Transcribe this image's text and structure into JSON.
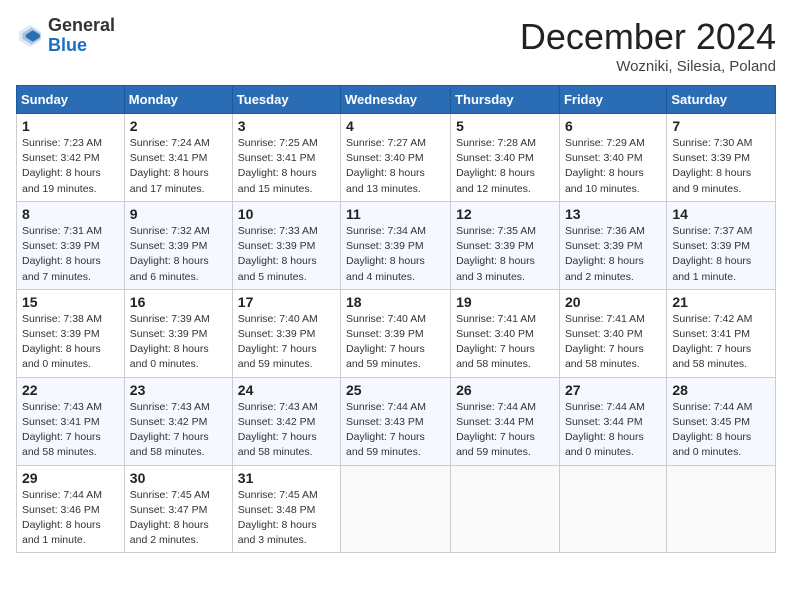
{
  "header": {
    "logo_general": "General",
    "logo_blue": "Blue",
    "month_title": "December 2024",
    "location": "Wozniki, Silesia, Poland"
  },
  "days_of_week": [
    "Sunday",
    "Monday",
    "Tuesday",
    "Wednesday",
    "Thursday",
    "Friday",
    "Saturday"
  ],
  "weeks": [
    [
      {
        "day": 1,
        "sunrise": "7:23 AM",
        "sunset": "3:42 PM",
        "daylight": "8 hours and 19 minutes."
      },
      {
        "day": 2,
        "sunrise": "7:24 AM",
        "sunset": "3:41 PM",
        "daylight": "8 hours and 17 minutes."
      },
      {
        "day": 3,
        "sunrise": "7:25 AM",
        "sunset": "3:41 PM",
        "daylight": "8 hours and 15 minutes."
      },
      {
        "day": 4,
        "sunrise": "7:27 AM",
        "sunset": "3:40 PM",
        "daylight": "8 hours and 13 minutes."
      },
      {
        "day": 5,
        "sunrise": "7:28 AM",
        "sunset": "3:40 PM",
        "daylight": "8 hours and 12 minutes."
      },
      {
        "day": 6,
        "sunrise": "7:29 AM",
        "sunset": "3:40 PM",
        "daylight": "8 hours and 10 minutes."
      },
      {
        "day": 7,
        "sunrise": "7:30 AM",
        "sunset": "3:39 PM",
        "daylight": "8 hours and 9 minutes."
      }
    ],
    [
      {
        "day": 8,
        "sunrise": "7:31 AM",
        "sunset": "3:39 PM",
        "daylight": "8 hours and 7 minutes."
      },
      {
        "day": 9,
        "sunrise": "7:32 AM",
        "sunset": "3:39 PM",
        "daylight": "8 hours and 6 minutes."
      },
      {
        "day": 10,
        "sunrise": "7:33 AM",
        "sunset": "3:39 PM",
        "daylight": "8 hours and 5 minutes."
      },
      {
        "day": 11,
        "sunrise": "7:34 AM",
        "sunset": "3:39 PM",
        "daylight": "8 hours and 4 minutes."
      },
      {
        "day": 12,
        "sunrise": "7:35 AM",
        "sunset": "3:39 PM",
        "daylight": "8 hours and 3 minutes."
      },
      {
        "day": 13,
        "sunrise": "7:36 AM",
        "sunset": "3:39 PM",
        "daylight": "8 hours and 2 minutes."
      },
      {
        "day": 14,
        "sunrise": "7:37 AM",
        "sunset": "3:39 PM",
        "daylight": "8 hours and 1 minute."
      }
    ],
    [
      {
        "day": 15,
        "sunrise": "7:38 AM",
        "sunset": "3:39 PM",
        "daylight": "8 hours and 0 minutes."
      },
      {
        "day": 16,
        "sunrise": "7:39 AM",
        "sunset": "3:39 PM",
        "daylight": "8 hours and 0 minutes."
      },
      {
        "day": 17,
        "sunrise": "7:40 AM",
        "sunset": "3:39 PM",
        "daylight": "7 hours and 59 minutes."
      },
      {
        "day": 18,
        "sunrise": "7:40 AM",
        "sunset": "3:39 PM",
        "daylight": "7 hours and 59 minutes."
      },
      {
        "day": 19,
        "sunrise": "7:41 AM",
        "sunset": "3:40 PM",
        "daylight": "7 hours and 58 minutes."
      },
      {
        "day": 20,
        "sunrise": "7:41 AM",
        "sunset": "3:40 PM",
        "daylight": "7 hours and 58 minutes."
      },
      {
        "day": 21,
        "sunrise": "7:42 AM",
        "sunset": "3:41 PM",
        "daylight": "7 hours and 58 minutes."
      }
    ],
    [
      {
        "day": 22,
        "sunrise": "7:43 AM",
        "sunset": "3:41 PM",
        "daylight": "7 hours and 58 minutes."
      },
      {
        "day": 23,
        "sunrise": "7:43 AM",
        "sunset": "3:42 PM",
        "daylight": "7 hours and 58 minutes."
      },
      {
        "day": 24,
        "sunrise": "7:43 AM",
        "sunset": "3:42 PM",
        "daylight": "7 hours and 58 minutes."
      },
      {
        "day": 25,
        "sunrise": "7:44 AM",
        "sunset": "3:43 PM",
        "daylight": "7 hours and 59 minutes."
      },
      {
        "day": 26,
        "sunrise": "7:44 AM",
        "sunset": "3:44 PM",
        "daylight": "7 hours and 59 minutes."
      },
      {
        "day": 27,
        "sunrise": "7:44 AM",
        "sunset": "3:44 PM",
        "daylight": "8 hours and 0 minutes."
      },
      {
        "day": 28,
        "sunrise": "7:44 AM",
        "sunset": "3:45 PM",
        "daylight": "8 hours and 0 minutes."
      }
    ],
    [
      {
        "day": 29,
        "sunrise": "7:44 AM",
        "sunset": "3:46 PM",
        "daylight": "8 hours and 1 minute."
      },
      {
        "day": 30,
        "sunrise": "7:45 AM",
        "sunset": "3:47 PM",
        "daylight": "8 hours and 2 minutes."
      },
      {
        "day": 31,
        "sunrise": "7:45 AM",
        "sunset": "3:48 PM",
        "daylight": "8 hours and 3 minutes."
      },
      null,
      null,
      null,
      null
    ]
  ]
}
